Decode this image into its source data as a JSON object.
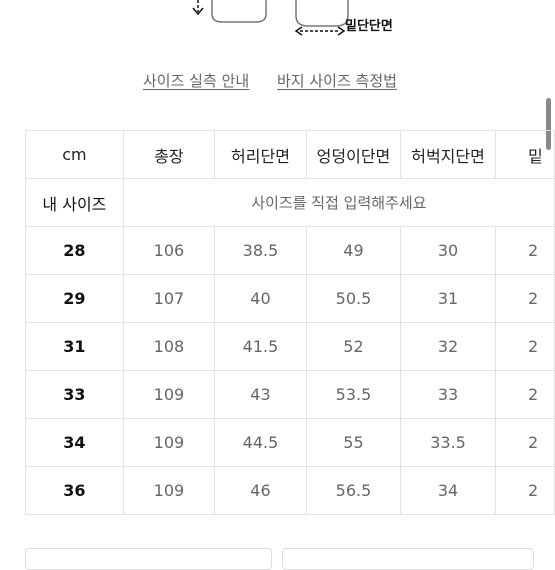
{
  "diagram": {
    "hem_label": "밑단단면"
  },
  "links": {
    "size_guide": "사이즈 실측 안내",
    "pants_measure": "바지 사이즈 측정법"
  },
  "table": {
    "headers": [
      "cm",
      "총장",
      "허리단면",
      "엉덩이단면",
      "허벅지단면",
      "밑"
    ],
    "my_size": {
      "label": "내 사이즈",
      "hint": "사이즈를 직접 입력해주세요"
    },
    "rows": [
      {
        "size": "28",
        "values": [
          "106",
          "38.5",
          "49",
          "30",
          "2"
        ]
      },
      {
        "size": "29",
        "values": [
          "107",
          "40",
          "50.5",
          "31",
          "2"
        ]
      },
      {
        "size": "31",
        "values": [
          "108",
          "41.5",
          "52",
          "32",
          "2"
        ]
      },
      {
        "size": "33",
        "values": [
          "109",
          "43",
          "53.5",
          "33",
          "2"
        ]
      },
      {
        "size": "34",
        "values": [
          "109",
          "44.5",
          "55",
          "33.5",
          "2"
        ]
      },
      {
        "size": "36",
        "values": [
          "109",
          "46",
          "56.5",
          "34",
          "2"
        ]
      }
    ]
  }
}
